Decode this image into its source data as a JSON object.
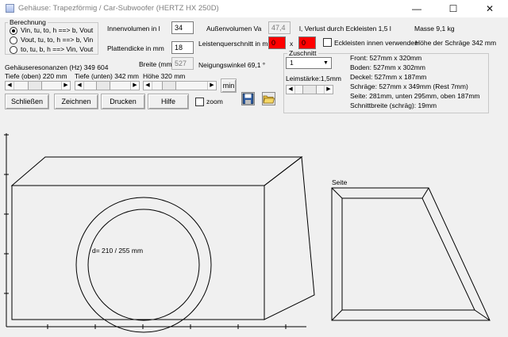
{
  "window": {
    "title": "Gehäuse: Trapezförmig / Car-Subwoofer (HERTZ HX 250D)",
    "minimize": "—",
    "maximize": "☐",
    "close": "✕"
  },
  "berechnung": {
    "title": "Berechnung",
    "options": [
      "Vin, tu, to, h ==>  b, Vout",
      "Vout, tu, to, h ==> b, Vin",
      "to, tu, b, h ==> Vin, Vout"
    ],
    "selected_index": 0
  },
  "fields": {
    "innenvolumen_label": "Innenvolumen in l",
    "innenvolumen_value": "34",
    "aussenvolumen_label": "Außenvolumen Va",
    "aussenvolumen_value": "47,4",
    "verlust_label": "l,  Verlust durch Eckleisten 1,5 l",
    "masse_label": "Masse 9,1 kg",
    "plattendicke_label": "Plattendicke in mm",
    "plattendicke_value": "18",
    "leisten_label": "Leistenquerschnitt in mm",
    "leisten_a": "0",
    "leisten_x": "x",
    "leisten_b": "0",
    "eckleisten_label": "Eckleisten innen verwenden",
    "schraege_hoehe_label": "Höhe der Schräge 342 mm",
    "resonanzen_label": "Gehäuseresonanzen (Hz) 349  604",
    "breite_label": "Breite (mm)",
    "breite_value": "527",
    "neigung_label": "Neigungswinkel 69,1 °"
  },
  "sliders": {
    "tiefe_oben_label": "Tiefe (oben) 220 mm",
    "tiefe_unten_label": "Tiefe (unten) 342 mm",
    "hoehe_label": "Höhe 320 mm",
    "min_button": "min",
    "leimstaerke_label": "Leimstärke:1,5mm",
    "tiefe_oben_fraction": 0.42,
    "tiefe_unten_fraction": 0.38,
    "hoehe_fraction": 0.24,
    "leimstaerke_fraction": 0.5
  },
  "buttons": {
    "schliessen": "Schließen",
    "zeichnen": "Zeichnen",
    "drucken": "Drucken",
    "hilfe": "Hilfe",
    "zoom": "zoom"
  },
  "zuschnitt": {
    "title": "Zuschnitt",
    "selected": "1",
    "lines": [
      "Front: 527mm x 320mm",
      "Boden: 527mm x 302mm",
      "Deckel: 527mm x 187mm",
      "Schräge: 527mm x 349mm (Rest 7mm)",
      "Seite: 281mm, unten 295mm, oben 187mm",
      "Schnittbreite (schräg): 19mm"
    ]
  },
  "drawing": {
    "driver_label": "d= 210 / 255 mm",
    "side_label": "Seite"
  },
  "icons": {
    "save": "save-icon",
    "open": "open-folder-icon"
  }
}
